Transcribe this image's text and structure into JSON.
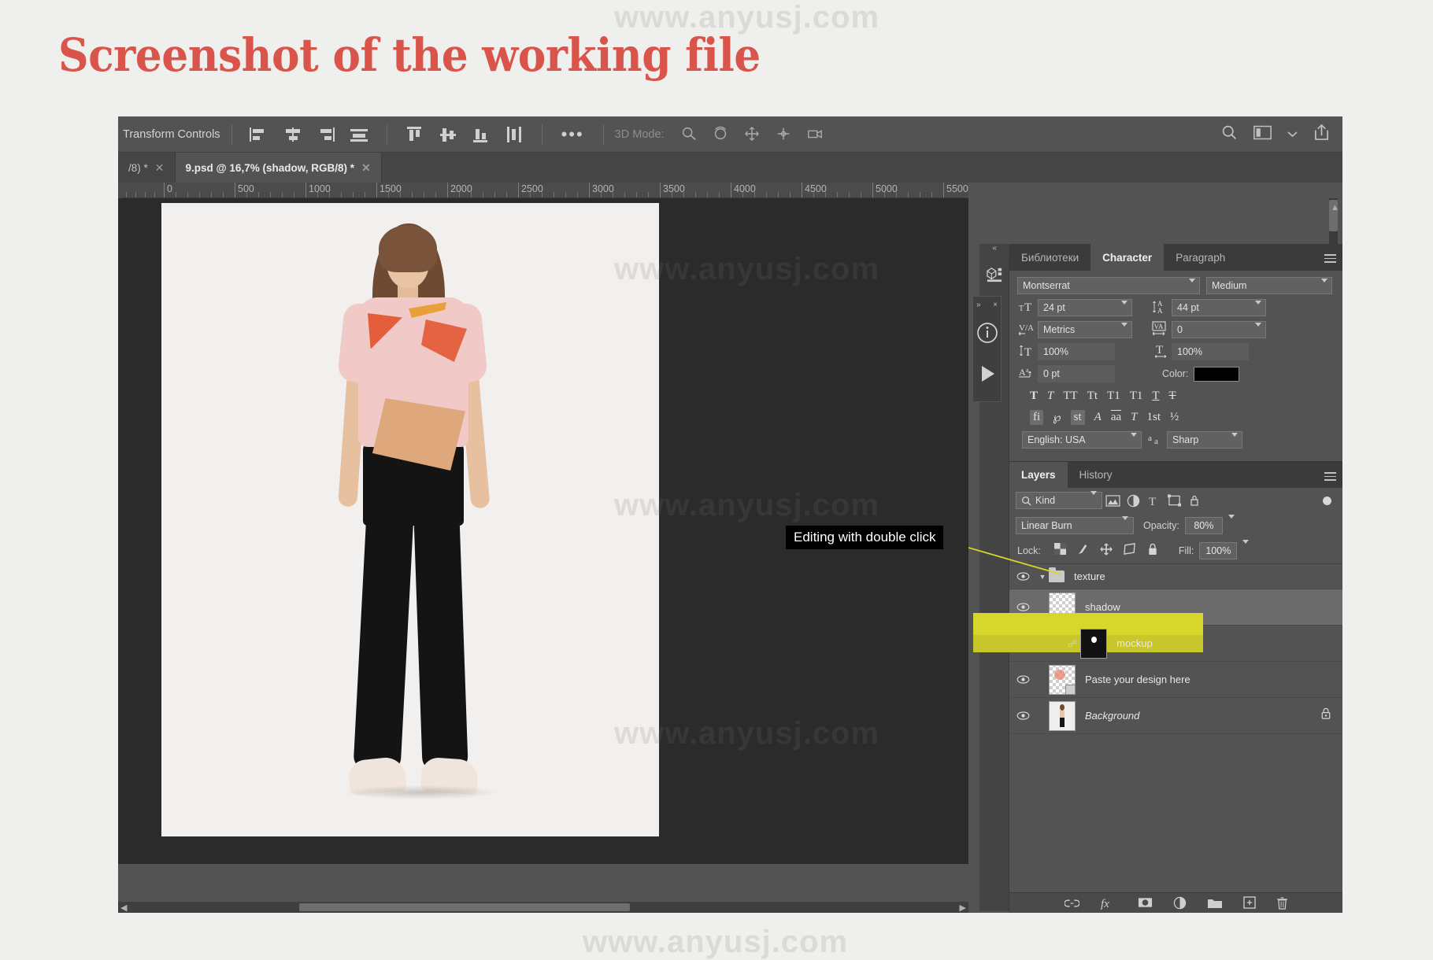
{
  "page": {
    "title": "Screenshot of the working file",
    "title_color": "#d9544a",
    "background": "#efefed",
    "watermark": "www.anyusj.com"
  },
  "options_bar": {
    "transform_controls_label": "Transform Controls",
    "align_icons": [
      "align-left-edges-icon",
      "align-horizontal-centers-icon",
      "align-right-edges-icon",
      "distribute-horizontally-icon"
    ],
    "align_icons_2": [
      "align-top-edges-icon",
      "align-vertical-centers-icon",
      "align-bottom-edges-icon",
      "distribute-vertically-icon"
    ],
    "more_label": "•••",
    "mode3d_label": "3D Mode:",
    "mode3d_icons": [
      "orbit-3d-icon",
      "roll-3d-icon",
      "pan-3d-icon",
      "slide-3d-icon",
      "camera-3d-icon"
    ],
    "right_icons": [
      "search-icon",
      "workspace-icon",
      "chevron-down-icon",
      "share-icon"
    ]
  },
  "tabs": [
    {
      "label": "/8) *",
      "active": false
    },
    {
      "label": "9.psd @ 16,7% (shadow, RGB/8) *",
      "active": true
    }
  ],
  "ruler": {
    "labels": [
      "0",
      "500",
      "1000",
      "1500",
      "2000",
      "2500",
      "3000",
      "3500",
      "4000",
      "4500",
      "5000",
      "5500"
    ],
    "unit": "px"
  },
  "mini_dock": {
    "collapse_label": "»",
    "close_label": "×",
    "items": [
      "info-icon",
      "play-icon"
    ]
  },
  "dock_strip": {
    "collapse_label": "«",
    "items": [
      "3d-panel-icon",
      "adjustments-panel-icon",
      "character-panel-icon"
    ]
  },
  "character": {
    "tabs": [
      {
        "label": "Библиотеки",
        "active": false
      },
      {
        "label": "Character",
        "active": true
      },
      {
        "label": "Paragraph",
        "active": false
      }
    ],
    "font_family": "Montserrat",
    "font_style": "Medium",
    "font_size": "24 pt",
    "leading": "44 pt",
    "kerning": "Metrics",
    "tracking": "0",
    "vertical_scale": "100%",
    "horizontal_scale": "100%",
    "baseline_shift": "0 pt",
    "color_label": "Color:",
    "color_value": "#000000",
    "style_glyphs": [
      "T",
      "T",
      "TT",
      "Tt",
      "T1",
      "T1",
      "T",
      "T"
    ],
    "ot_glyphs": [
      "fi",
      "℘",
      "st",
      "A",
      "aa",
      "T",
      "1st",
      "½"
    ],
    "language": "English: USA",
    "antialias": "Sharp",
    "aa_icon": "aa-icon",
    "size_icon": "font-size-icon",
    "leading_icon": "leading-icon",
    "kerning_icon": "kerning-icon",
    "tracking_icon": "tracking-icon",
    "vscale_icon": "vertical-scale-icon",
    "hscale_icon": "horizontal-scale-icon",
    "baseline_icon": "baseline-shift-icon"
  },
  "layers": {
    "tabs": [
      {
        "label": "Layers",
        "active": true
      },
      {
        "label": "History",
        "active": false
      }
    ],
    "filter_label": "Kind",
    "filter_icons": [
      "pixel-filter-icon",
      "adjustment-filter-icon",
      "type-filter-icon",
      "shape-filter-icon",
      "smartobject-filter-icon"
    ],
    "blend_mode": "Linear Burn",
    "opacity_label": "Opacity:",
    "opacity_value": "80%",
    "lock_label": "Lock:",
    "lock_icons": [
      "lock-transparency-icon",
      "lock-image-icon",
      "lock-position-icon",
      "lock-artboard-icon",
      "lock-all-icon"
    ],
    "fill_label": "Fill:",
    "fill_value": "100%",
    "rows": [
      {
        "name": "texture",
        "type": "group",
        "indent": 0,
        "selected": false,
        "expanded": true,
        "locked": false,
        "italic": false,
        "thumb": "none"
      },
      {
        "name": "shadow",
        "type": "layer",
        "indent": 1,
        "selected": true,
        "expanded": false,
        "locked": false,
        "italic": false,
        "thumb": "transparent"
      },
      {
        "name": "mockup",
        "type": "group",
        "indent": 0,
        "selected": false,
        "expanded": true,
        "locked": false,
        "italic": false,
        "thumb": "mask"
      },
      {
        "name": "Paste your design here",
        "type": "smart",
        "indent": 1,
        "selected": false,
        "expanded": false,
        "locked": false,
        "italic": false,
        "thumb": "design"
      },
      {
        "name": "Background",
        "type": "layer",
        "indent": 0,
        "selected": false,
        "expanded": false,
        "locked": true,
        "italic": true,
        "thumb": "photo"
      }
    ],
    "bottom_icons": [
      "link-layers-icon",
      "layer-style-fx-icon",
      "layer-mask-icon",
      "adjustment-layer-icon",
      "new-group-icon",
      "new-layer-icon",
      "delete-layer-icon"
    ],
    "highlight_color": "#d7d62b"
  },
  "callout": {
    "text": "Editing with double click",
    "background": "#000000",
    "text_color": "#ffffff",
    "line_color": "#d7d62b"
  }
}
